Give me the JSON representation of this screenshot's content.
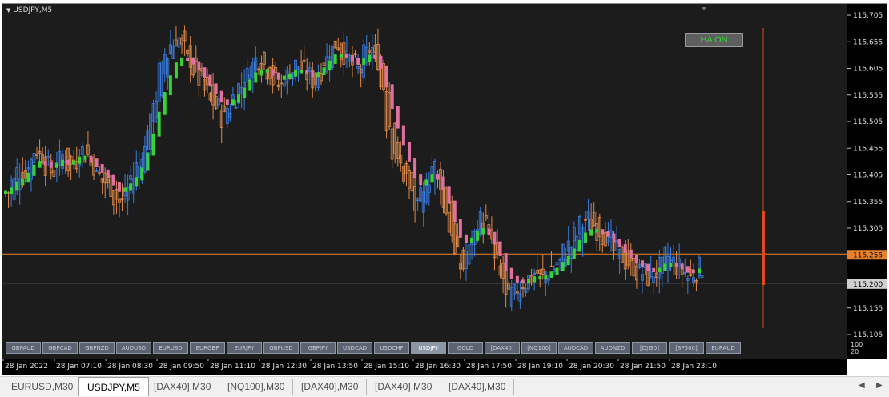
{
  "chart": {
    "title": "USDJPY,M5",
    "ha_button": "HA ON",
    "current_price": "115.255",
    "bid_label": "115.200",
    "indicator_scale": [
      "100",
      "20"
    ]
  },
  "price_axis": [
    "115.705",
    "115.655",
    "115.605",
    "115.555",
    "115.505",
    "115.455",
    "115.405",
    "115.355",
    "115.305",
    "115.255",
    "115.205",
    "115.155",
    "115.105"
  ],
  "time_axis": [
    "28 Jan 2022",
    "28 Jan 07:10",
    "28 Jan 08:30",
    "28 Jan 09:50",
    "28 Jan 11:10",
    "28 Jan 12:30",
    "28 Jan 13:50",
    "28 Jan 15:10",
    "28 Jan 16:30",
    "28 Jan 17:50",
    "28 Jan 19:10",
    "28 Jan 20:30",
    "28 Jan 21:50",
    "28 Jan 23:10"
  ],
  "symbol_buttons": [
    "GBPAUD",
    "GBPCAD",
    "GBPNZD",
    "AUDUSD",
    "EURUSD",
    "EURGBP",
    "EURJPY",
    "GBPUSD",
    "GBPJPY",
    "USDCAD",
    "USDCHF",
    "USDJPY",
    "GOLD",
    "[DAX40]",
    "[NQ100]",
    "AUDCAD",
    "AUDNZD",
    "[DJI30]",
    "[SP500]",
    "EURAUD"
  ],
  "active_symbol": "USDJPY",
  "tabs": [
    "EURUSD,M30",
    "USDJPY,M5",
    "[DAX40],M30",
    "[NQ100],M30",
    "[DAX40],M30",
    "[DAX40],M30",
    "[DAX40],M30"
  ],
  "active_tab": 1,
  "chart_data": {
    "type": "candlestick",
    "title": "USDJPY,M5",
    "ylim": [
      115.105,
      115.705
    ],
    "price_series": [
      115.37,
      115.39,
      115.41,
      115.4,
      115.43,
      115.45,
      115.44,
      115.42,
      115.41,
      115.43,
      115.44,
      115.42,
      115.43,
      115.45,
      115.44,
      115.42,
      115.4,
      115.39,
      115.38,
      115.36,
      115.35,
      115.38,
      115.4,
      115.42,
      115.45,
      115.5,
      115.55,
      115.6,
      115.63,
      115.65,
      115.66,
      115.64,
      115.62,
      115.6,
      115.58,
      115.56,
      115.54,
      115.53,
      115.51,
      115.53,
      115.55,
      115.57,
      115.59,
      115.61,
      115.62,
      115.61,
      115.6,
      115.58,
      115.57,
      115.59,
      115.6,
      115.61,
      115.6,
      115.59,
      115.58,
      115.6,
      115.62,
      115.64,
      115.65,
      115.63,
      115.62,
      115.61,
      115.6,
      115.63,
      115.64,
      115.62,
      115.57,
      115.5,
      115.45,
      115.42,
      115.4,
      115.37,
      115.34,
      115.36,
      115.4,
      115.42,
      115.39,
      115.34,
      115.3,
      115.25,
      115.23,
      115.26,
      115.29,
      115.32,
      115.31,
      115.28,
      115.24,
      115.21,
      115.17,
      115.18,
      115.19,
      115.2,
      115.21,
      115.22,
      115.21,
      115.22,
      115.23,
      115.24,
      115.26,
      115.27,
      115.29,
      115.31,
      115.32,
      115.31,
      115.3,
      115.29,
      115.28,
      115.26,
      115.25,
      115.24,
      115.23,
      115.22,
      115.22,
      115.21,
      115.22,
      115.23,
      115.25,
      115.24,
      115.23,
      115.22,
      115.21,
      115.22,
      115.23
    ],
    "xlabel": "",
    "ylabel": ""
  }
}
